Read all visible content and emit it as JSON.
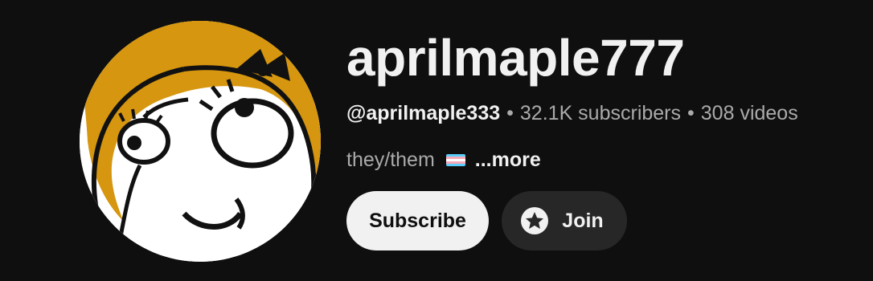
{
  "channel": {
    "name": "aprilmaple777",
    "handle": "@aprilmaple333",
    "separator": "•",
    "subscribers": "32.1K subscribers",
    "videos": "308 videos",
    "description": "they/them",
    "description_flag_icon": "transgender-flag-icon",
    "more_label": "...more",
    "avatar_icon": "rage-comic-derp-girl-avatar"
  },
  "actions": {
    "subscribe_label": "Subscribe",
    "join_label": "Join",
    "join_icon": "star-badge-icon"
  },
  "colors": {
    "background": "#0f0f0f",
    "text_primary": "#f1f1f1",
    "text_secondary": "#aaaaaa",
    "subscribe_bg": "#f1f1f1",
    "join_bg": "#272727",
    "flag_blue": "#5bcefa",
    "flag_pink": "#f5a9b8",
    "flag_white": "#ffffff",
    "avatar_hair": "#d6960f"
  }
}
